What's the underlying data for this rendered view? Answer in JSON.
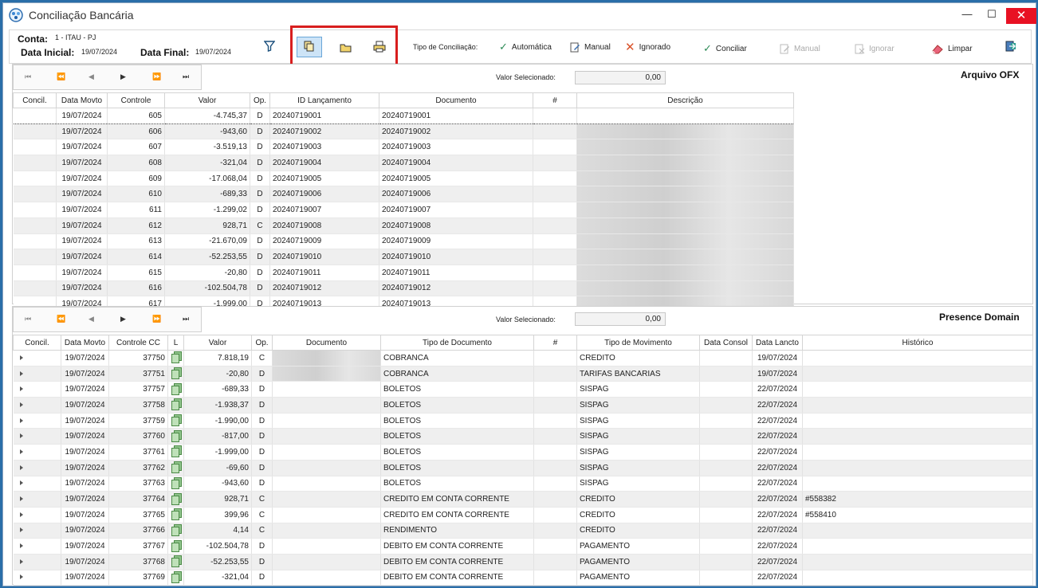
{
  "window": {
    "title": "Conciliação Bancária",
    "min": "—",
    "max": "☐",
    "close": "✕"
  },
  "header": {
    "conta_label": "Conta:",
    "conta_value": "1 - ITAU - PJ",
    "data_inicial_label": "Data Inicial:",
    "data_inicial_value": "19/07/2024",
    "data_final_label": "Data Final:",
    "data_final_value": "19/07/2024",
    "tipo_label": "Tipo de Conciliação:",
    "automatica": "Automática",
    "manual": "Manual",
    "ignorado": "Ignorado",
    "conciliar": "Conciliar",
    "manual_action": "Manual",
    "ignorar": "Ignorar",
    "limpar": "Limpar",
    "icons": [
      "filter-icon",
      "copy-files-icon",
      "folder-icon",
      "printer-icon",
      "exit-icon"
    ]
  },
  "colors": {
    "highlight": "#d81e1e",
    "selected_bg": "#cde4f7",
    "check": "#2e8b57",
    "x": "#d9532b"
  },
  "ofx": {
    "nav": [
      "⏮",
      "⏪",
      "◀",
      "▶",
      "⏩",
      "⏭"
    ],
    "valor_label": "Valor Selecionado:",
    "valor_value": "0,00",
    "title": "Arquivo OFX",
    "columns": [
      "Concil.",
      "Data Movto",
      "Controle",
      "Valor",
      "Op.",
      "ID Lançamento",
      "Documento",
      "#",
      "Descrição"
    ],
    "rows": [
      [
        "",
        "19/07/2024",
        "605",
        "-4.745,37",
        "D",
        "20240719001",
        "20240719001",
        "",
        ""
      ],
      [
        "",
        "19/07/2024",
        "606",
        "-943,60",
        "D",
        "20240719002",
        "20240719002",
        "",
        ""
      ],
      [
        "",
        "19/07/2024",
        "607",
        "-3.519,13",
        "D",
        "20240719003",
        "20240719003",
        "",
        ""
      ],
      [
        "",
        "19/07/2024",
        "608",
        "-321,04",
        "D",
        "20240719004",
        "20240719004",
        "",
        ""
      ],
      [
        "",
        "19/07/2024",
        "609",
        "-17.068,04",
        "D",
        "20240719005",
        "20240719005",
        "",
        ""
      ],
      [
        "",
        "19/07/2024",
        "610",
        "-689,33",
        "D",
        "20240719006",
        "20240719006",
        "",
        ""
      ],
      [
        "",
        "19/07/2024",
        "611",
        "-1.299,02",
        "D",
        "20240719007",
        "20240719007",
        "",
        ""
      ],
      [
        "",
        "19/07/2024",
        "612",
        "928,71",
        "C",
        "20240719008",
        "20240719008",
        "",
        ""
      ],
      [
        "",
        "19/07/2024",
        "613",
        "-21.670,09",
        "D",
        "20240719009",
        "20240719009",
        "",
        ""
      ],
      [
        "",
        "19/07/2024",
        "614",
        "-52.253,55",
        "D",
        "20240719010",
        "20240719010",
        "",
        ""
      ],
      [
        "",
        "19/07/2024",
        "615",
        "-20,80",
        "D",
        "20240719011",
        "20240719011",
        "",
        ""
      ],
      [
        "",
        "19/07/2024",
        "616",
        "-102.504,78",
        "D",
        "20240719012",
        "20240719012",
        "",
        ""
      ],
      [
        "",
        "19/07/2024",
        "617",
        "-1.999,00",
        "D",
        "20240719013",
        "20240719013",
        "",
        ""
      ]
    ]
  },
  "presence": {
    "nav": [
      "⏮",
      "⏪",
      "◀",
      "▶",
      "⏩",
      "⏭"
    ],
    "valor_label": "Valor Selecionado:",
    "valor_value": "0,00",
    "title": "Presence Domain",
    "columns": [
      "Concil.",
      "Data Movto",
      "Controle CC",
      "L",
      "Valor",
      "Op.",
      "Documento",
      "Tipo de Documento",
      "#",
      "Tipo de Movimento",
      "Data Consol",
      "Data Lancto",
      "Histórico"
    ],
    "rows": [
      [
        "19/07/2024",
        "37750",
        "7.818,19",
        "C",
        "",
        "COBRANCA",
        "",
        "CREDITO",
        "",
        "19/07/2024",
        ""
      ],
      [
        "19/07/2024",
        "37751",
        "-20,80",
        "D",
        "",
        "COBRANCA",
        "",
        "TARIFAS BANCARIAS",
        "",
        "19/07/2024",
        ""
      ],
      [
        "19/07/2024",
        "37757",
        "-689,33",
        "D",
        "",
        "BOLETOS",
        "",
        "SISPAG",
        "",
        "22/07/2024",
        ""
      ],
      [
        "19/07/2024",
        "37758",
        "-1.938,37",
        "D",
        "",
        "BOLETOS",
        "",
        "SISPAG",
        "",
        "22/07/2024",
        ""
      ],
      [
        "19/07/2024",
        "37759",
        "-1.990,00",
        "D",
        "",
        "BOLETOS",
        "",
        "SISPAG",
        "",
        "22/07/2024",
        ""
      ],
      [
        "19/07/2024",
        "37760",
        "-817,00",
        "D",
        "",
        "BOLETOS",
        "",
        "SISPAG",
        "",
        "22/07/2024",
        ""
      ],
      [
        "19/07/2024",
        "37761",
        "-1.999,00",
        "D",
        "",
        "BOLETOS",
        "",
        "SISPAG",
        "",
        "22/07/2024",
        ""
      ],
      [
        "19/07/2024",
        "37762",
        "-69,60",
        "D",
        "",
        "BOLETOS",
        "",
        "SISPAG",
        "",
        "22/07/2024",
        ""
      ],
      [
        "19/07/2024",
        "37763",
        "-943,60",
        "D",
        "",
        "BOLETOS",
        "",
        "SISPAG",
        "",
        "22/07/2024",
        ""
      ],
      [
        "19/07/2024",
        "37764",
        "928,71",
        "C",
        "",
        "CREDITO EM CONTA CORRENTE",
        "",
        "CREDITO",
        "",
        "22/07/2024",
        "#558382"
      ],
      [
        "19/07/2024",
        "37765",
        "399,96",
        "C",
        "",
        "CREDITO EM CONTA CORRENTE",
        "",
        "CREDITO",
        "",
        "22/07/2024",
        "#558410"
      ],
      [
        "19/07/2024",
        "37766",
        "4,14",
        "C",
        "",
        "RENDIMENTO",
        "",
        "CREDITO",
        "",
        "22/07/2024",
        ""
      ],
      [
        "19/07/2024",
        "37767",
        "-102.504,78",
        "D",
        "",
        "DEBITO EM CONTA CORRENTE",
        "",
        "PAGAMENTO",
        "",
        "22/07/2024",
        ""
      ],
      [
        "19/07/2024",
        "37768",
        "-52.253,55",
        "D",
        "",
        "DEBITO EM CONTA CORRENTE",
        "",
        "PAGAMENTO",
        "",
        "22/07/2024",
        ""
      ],
      [
        "19/07/2024",
        "37769",
        "-321,04",
        "D",
        "",
        "DEBITO EM CONTA CORRENTE",
        "",
        "PAGAMENTO",
        "",
        "22/07/2024",
        ""
      ]
    ]
  }
}
